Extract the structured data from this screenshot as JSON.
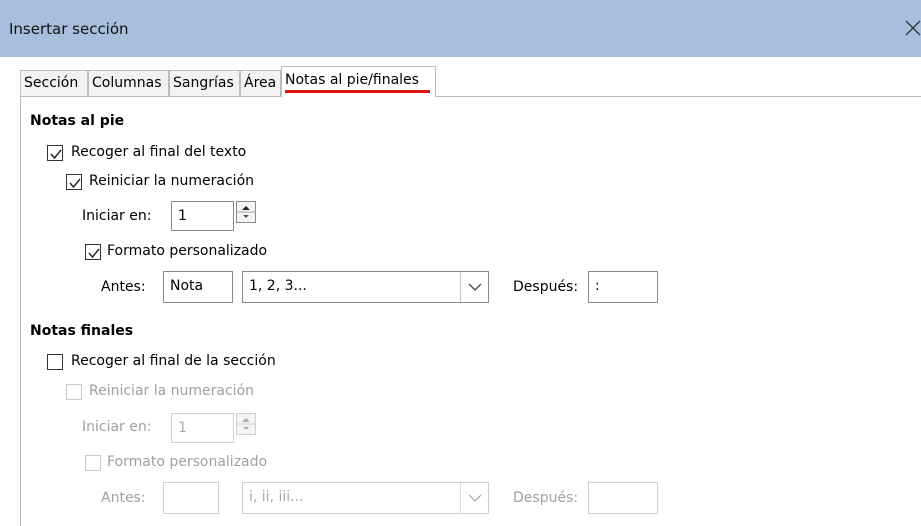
{
  "window": {
    "title": "Insertar sección"
  },
  "tabs": [
    {
      "label": "Sección"
    },
    {
      "label": "Columnas"
    },
    {
      "label": "Sangrías"
    },
    {
      "label": "Área"
    },
    {
      "label": "Notas al pie/finales",
      "active": true
    }
  ],
  "footnotes": {
    "heading": "Notas al pie",
    "collect": {
      "label": "Recoger al final del texto",
      "checked": true
    },
    "restart": {
      "label": "Reiniciar la numeración",
      "checked": true
    },
    "start_label": "Iniciar en:",
    "start_value": "1",
    "custom": {
      "label": "Formato personalizado",
      "checked": true
    },
    "before_label": "Antes:",
    "before_value": "Nota",
    "format_value": "1, 2, 3...",
    "after_label": "Después:",
    "after_value": ":"
  },
  "endnotes": {
    "heading": "Notas finales",
    "collect": {
      "label": "Recoger al final de la sección",
      "checked": false
    },
    "restart": {
      "label": "Reiniciar la numeración",
      "checked": false
    },
    "start_label": "Iniciar en:",
    "start_value": "1",
    "custom": {
      "label": "Formato personalizado",
      "checked": false
    },
    "before_label": "Antes:",
    "before_value": "",
    "format_value": "i, ii, iii...",
    "after_label": "Después:",
    "after_value": ""
  },
  "icons": {
    "close": "close-icon",
    "check": "checkmark-icon",
    "spin_up": "triangle-up-icon",
    "spin_down": "triangle-down-icon",
    "dropdown": "chevron-down-icon"
  },
  "colors": {
    "titlebar": "#a7bfdc",
    "tab_indicator": "#e01414",
    "disabled_text": "#a0a0a0"
  }
}
